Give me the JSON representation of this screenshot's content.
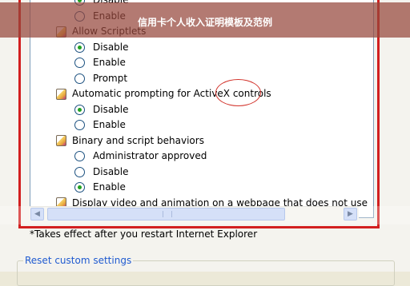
{
  "banner": {
    "title": "信用卡个人收入证明模板及范例"
  },
  "settings": {
    "items": [
      {
        "kind": "option",
        "label": "Disable",
        "selected": true
      },
      {
        "kind": "option",
        "label": "Enable",
        "selected": false
      },
      {
        "kind": "category",
        "label": "Allow Scriptlets"
      },
      {
        "kind": "option",
        "label": "Disable",
        "selected": true
      },
      {
        "kind": "option",
        "label": "Enable",
        "selected": false
      },
      {
        "kind": "option",
        "label": "Prompt",
        "selected": false
      },
      {
        "kind": "category",
        "label": "Automatic prompting for ActiveX controls"
      },
      {
        "kind": "option",
        "label": "Disable",
        "selected": true
      },
      {
        "kind": "option",
        "label": "Enable",
        "selected": false
      },
      {
        "kind": "category",
        "label": "Binary and script behaviors"
      },
      {
        "kind": "option",
        "label": "Administrator approved",
        "selected": false
      },
      {
        "kind": "option",
        "label": "Disable",
        "selected": false
      },
      {
        "kind": "option",
        "label": "Enable",
        "selected": true
      },
      {
        "kind": "category",
        "label": "Display video and animation on a webpage that does not use"
      }
    ]
  },
  "footnote": "*Takes effect after you restart Internet Explorer",
  "reset_group": {
    "title": "Reset custom settings"
  }
}
